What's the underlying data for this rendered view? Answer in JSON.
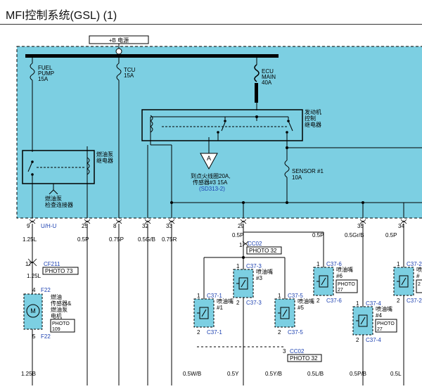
{
  "title": "MFI控制系统(GSL) (1)",
  "power": {
    "label": "+B 电源"
  },
  "fuses": {
    "fuel_pump": {
      "name": "FUEL\nPUMP",
      "rating": "15A"
    },
    "tcu": {
      "name": "TCU",
      "rating": "15A"
    },
    "ecu_main": {
      "name": "ECU\nMAIN",
      "rating": "40A"
    },
    "sensor1": {
      "name": "SENSOR #1",
      "rating": "10A"
    }
  },
  "relays": {
    "engine": "发动机\n控制\n继电器",
    "fuel_pump": "燃油泵\n继电器",
    "check_connector": "燃油泵\n检查连接器"
  },
  "ref_a": {
    "letter": "A",
    "text1": "到点火线圈20A,",
    "text2": "传感器#3 15A",
    "link": "(SD313-2)"
  },
  "pins": [
    {
      "num": "9",
      "sig": "U/H-U",
      "wire": "1.25L"
    },
    {
      "num": "25",
      "sig": "",
      "wire": "0.5P"
    },
    {
      "num": "8",
      "sig": "",
      "wire": "0.75P"
    },
    {
      "num": "32",
      "sig": "",
      "wire": "0.5G/B"
    },
    {
      "num": "33",
      "sig": "",
      "wire": "0.75R"
    },
    {
      "num": "29",
      "sig": "",
      "wire": "0.5P"
    },
    {
      "num": "35",
      "sig": "",
      "wire": "0.5Gr/B"
    },
    {
      "num": "34",
      "sig": "",
      "wire": "0.5P"
    }
  ],
  "connectors": {
    "cf211": {
      "pin": "17",
      "name": "CF211",
      "photo": "PHOTO 73"
    },
    "cc02_top": {
      "pin": "1",
      "name": "CC02",
      "photo": "PHOTO 32"
    },
    "cc02_bot": {
      "pin": "3",
      "name": "CC02",
      "photo": "PHOTO 32"
    },
    "f22_top": {
      "pin": "4",
      "name": "F22"
    },
    "f22_bot": {
      "pin": "5",
      "name": "F22"
    }
  },
  "fuel_motor": {
    "label": "燃油\n传感器&\n燃油泵\n电机",
    "photo": "PHOTO\n109",
    "symbol": "M"
  },
  "injectors": [
    {
      "id": "3",
      "conn": "C37-3",
      "label": "喷油嘴\n#3",
      "photo": ""
    },
    {
      "id": "1",
      "conn": "C37-1",
      "label": "喷油嘴\n#1",
      "photo": ""
    },
    {
      "id": "5",
      "conn": "C37-5",
      "label": "喷油嘴\n#5",
      "photo": ""
    },
    {
      "id": "6",
      "conn": "C37-6",
      "label": "喷油嘴\n#6",
      "photo": "PHOTO\n27"
    },
    {
      "id": "4",
      "conn": "C37-4",
      "label": "喷油嘴\n#4",
      "photo": "PHOTO\n27"
    },
    {
      "id": "2",
      "conn": "C37-2",
      "label": "喷\n#",
      "photo": "2"
    }
  ],
  "bottom_wires": [
    "1.25B",
    "0.5W/B",
    "0.5Y",
    "0.5Y/B",
    "0.5L/B",
    "0.5P/B",
    "0.5L"
  ],
  "mid_wires": [
    "0.5P",
    "1.25L",
    "0.5P"
  ],
  "colors": {
    "module_fill": "#7ccfe2",
    "link": "#1a3fb0",
    "line": "#000000"
  }
}
